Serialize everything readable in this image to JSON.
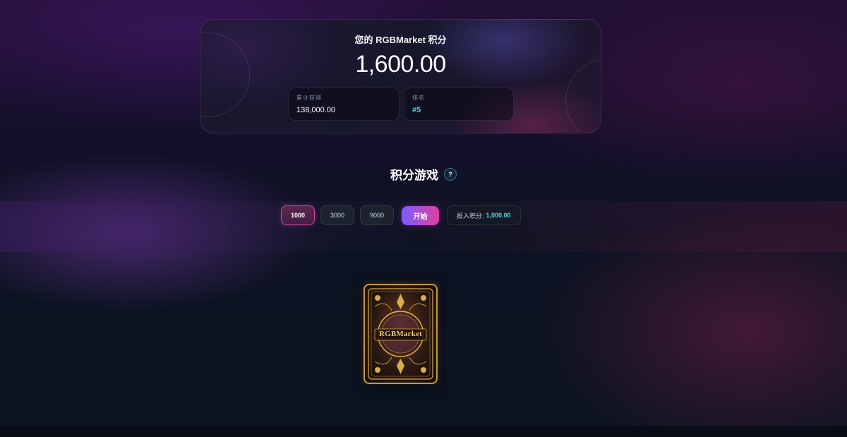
{
  "points": {
    "title": "您的 RGBMarket 积分",
    "balance": "1,600.00",
    "earned_label": "累计获得",
    "earned_value": "138,000.00",
    "rank_label": "排名",
    "rank_value": "#5"
  },
  "game": {
    "title": "积分游戏",
    "help_label": "?",
    "amounts": [
      "1000",
      "3000",
      "9000"
    ],
    "selected_amount": "1000",
    "start_label": "开始",
    "bet_label": "投入积分:",
    "bet_value": "1,000.00"
  },
  "card": {
    "brand": "RGBMarket"
  },
  "colors": {
    "accent_cyan": "#56d6e6",
    "accent_pink": "#e040a0",
    "accent_purple": "#7a5cff",
    "card_gold": "#c69a3c"
  }
}
